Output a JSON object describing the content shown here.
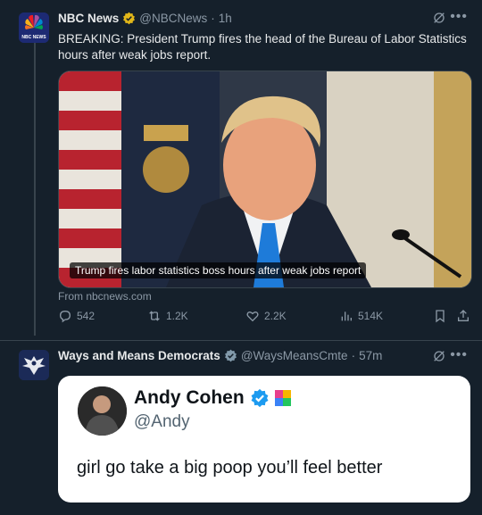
{
  "tweets": [
    {
      "author": "NBC News",
      "handle": "@NBCNews",
      "time": "1h",
      "text": "BREAKING: President Trump fires the head of the Bureau of Labor Statistics hours after weak jobs report.",
      "media_caption": "Trump fires labor statistics boss hours after weak jobs report",
      "source": "From nbcnews.com",
      "stats": {
        "replies": "542",
        "reposts": "1.2K",
        "likes": "2.2K",
        "views": "514K"
      },
      "logo_text": "NBC NEWS"
    },
    {
      "author": "Ways and Means Democrats",
      "handle": "@WaysMeansCmte",
      "time": "57m",
      "quoted": {
        "name": "Andy Cohen",
        "handle": "@Andy",
        "text": "girl go take a big poop you’ll feel better"
      }
    }
  ],
  "separator": "·",
  "colors": {
    "background": "#15202b",
    "gold_badge": "#e2b719",
    "gray_badge": "#829aab",
    "blue_badge": "#1d9bf0",
    "muted": "#8b98a5"
  },
  "icons": [
    "grok-icon",
    "more-icon",
    "reply-icon",
    "repost-icon",
    "like-icon",
    "views-icon",
    "bookmark-icon",
    "share-icon"
  ]
}
